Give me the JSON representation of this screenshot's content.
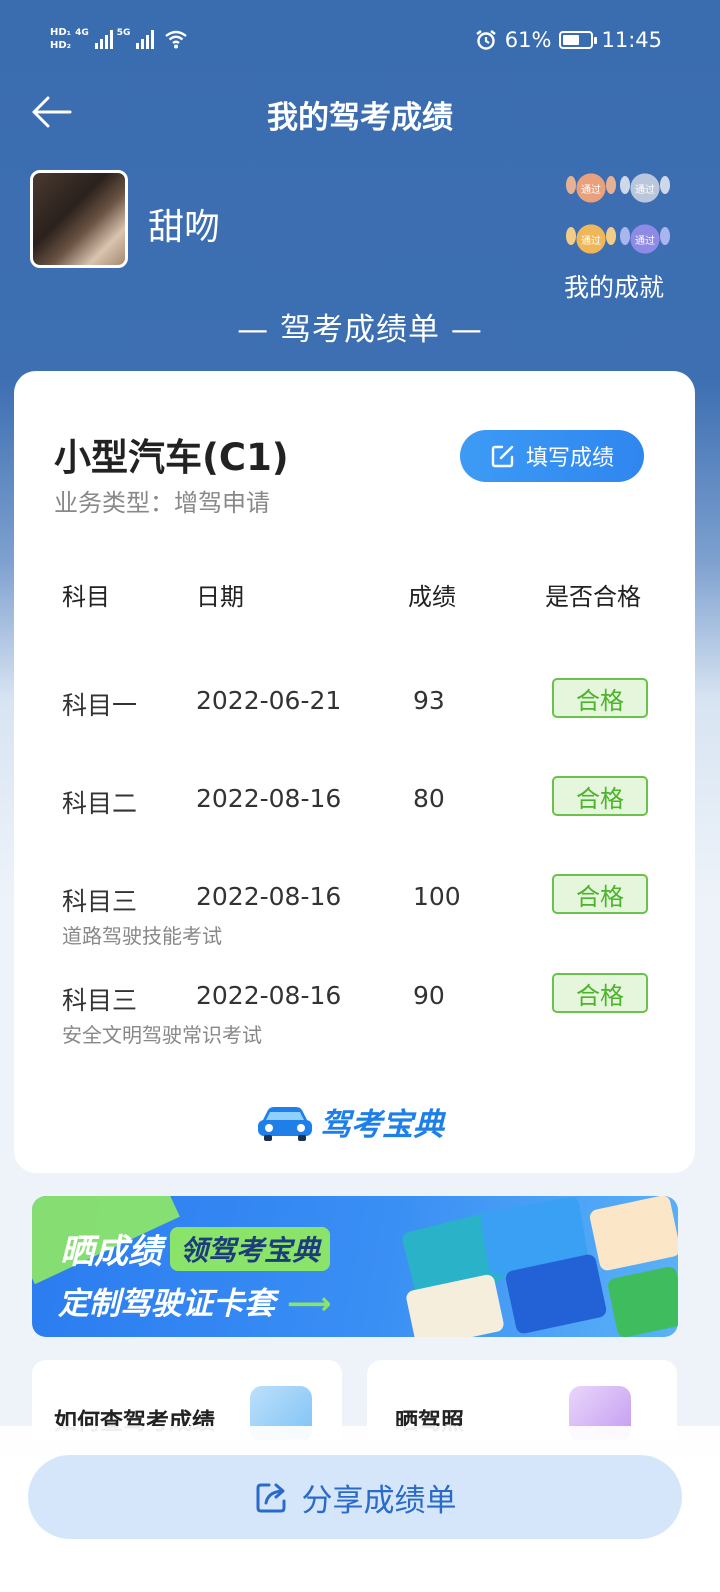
{
  "status_bar": {
    "hd1": "HD₁",
    "hd2": "HD₂",
    "net1": "4G",
    "net2": "5G",
    "battery_percent": "61%",
    "battery_level": 0.61,
    "time": "11:45"
  },
  "header": {
    "title": "我的驾考成绩",
    "back_icon": "back-arrow-icon"
  },
  "profile": {
    "username": "甜吻",
    "achievements_label": "我的成就",
    "medals": [
      {
        "label": "通过",
        "color": "#e9a07c"
      },
      {
        "label": "通过",
        "color": "#b9c6dc"
      },
      {
        "label": "通过",
        "color": "#f0b75a"
      },
      {
        "label": "通过",
        "color": "#8f8ae6"
      }
    ]
  },
  "report_heading": "— 驾考成绩单 —",
  "card": {
    "license_class": "小型汽车(C1)",
    "business_type": "业务类型：增驾申请",
    "fill_button_label": "填写成绩",
    "columns": [
      "科目",
      "日期",
      "成绩",
      "是否合格"
    ],
    "rows": [
      {
        "subject": "科目一",
        "date": "2022-06-21",
        "score": "93",
        "result": "合格",
        "note": ""
      },
      {
        "subject": "科目二",
        "date": "2022-08-16",
        "score": "80",
        "result": "合格",
        "note": ""
      },
      {
        "subject": "科目三",
        "date": "2022-08-16",
        "score": "100",
        "result": "合格",
        "note": "道路驾驶技能考试"
      },
      {
        "subject": "科目三",
        "date": "2022-08-16",
        "score": "90",
        "result": "合格",
        "note": "安全文明驾驶常识考试"
      }
    ],
    "logo_text": "驾考宝典"
  },
  "banner": {
    "line1_big": "晒成绩",
    "line1_pill": "领驾考宝典",
    "line2": "定制驾驶证卡套",
    "accent_color": "#8be46a"
  },
  "entries": [
    {
      "label": "如何查驾考成绩"
    },
    {
      "label": "晒驾照"
    }
  ],
  "share_button": {
    "label": "分享成绩单",
    "icon": "share-icon"
  },
  "colors": {
    "primary": "#3a6cb0",
    "button_blue": "#3d9bf5",
    "pass_green": "#4bb42c"
  }
}
